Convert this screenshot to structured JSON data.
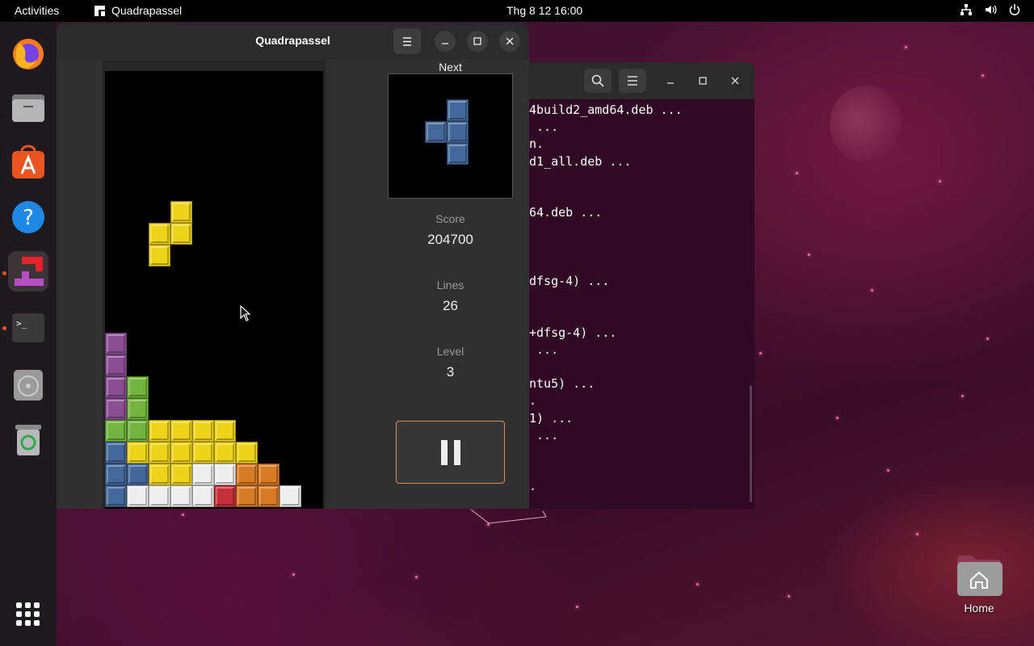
{
  "topbar": {
    "activities": "Activities",
    "app_name": "Quadrapassel",
    "clock": "Thg 8 12  16:00",
    "tray_icons": [
      "network-icon",
      "volume-icon",
      "power-icon"
    ]
  },
  "dock": {
    "items": [
      "firefox-icon",
      "files-icon",
      "app-center-icon",
      "help-icon",
      "quadrapassel-icon",
      "terminal-icon",
      "disc-icon",
      "trash-icon"
    ],
    "show_apps": "show-apps-icon"
  },
  "terminal": {
    "lines": [
      "4build2_amd64.deb ...",
      " ...",
      "n.",
      "d1_all.deb ...",
      "",
      "",
      "64.deb ...",
      "",
      "",
      "",
      "dfsg-4) ...",
      "",
      "",
      "+dfsg-4) ...",
      " ...",
      "",
      "ntu5) ...",
      ".",
      "1) ...",
      " ...",
      "",
      "",
      "."
    ]
  },
  "game": {
    "window_title": "Quadrapassel",
    "next_label": "Next",
    "score_label": "Score",
    "score": "204700",
    "lines_label": "Lines",
    "lines": "26",
    "level_label": "Level",
    "level": "3",
    "colors": {
      "purple": "#8a4f92",
      "green": "#72b43e",
      "yellow": "#eed31b",
      "blue": "#44689a",
      "white": "#eeeeee",
      "orange": "#d77b26",
      "red": "#c6303a"
    },
    "falling_piece": {
      "color": "yellow",
      "cells": [
        [
          3,
          6
        ],
        [
          2,
          7
        ],
        [
          3,
          7
        ],
        [
          2,
          8
        ]
      ]
    },
    "next_piece": {
      "color": "blue",
      "cells": [
        [
          1,
          0
        ],
        [
          0,
          1
        ],
        [
          1,
          1
        ],
        [
          1,
          2
        ]
      ]
    },
    "board": [
      {
        "row": 12,
        "cells": [
          "purple"
        ]
      },
      {
        "row": 13,
        "cells": [
          "purple"
        ]
      },
      {
        "row": 14,
        "cells": [
          "purple",
          "green"
        ]
      },
      {
        "row": 15,
        "cells": [
          "purple",
          "green"
        ]
      },
      {
        "row": 16,
        "cells": [
          "green",
          "green",
          "yellow",
          "yellow",
          "yellow",
          "yellow"
        ]
      },
      {
        "row": 17,
        "cells": [
          "blue",
          "yellow",
          "yellow",
          "yellow",
          "yellow",
          "yellow",
          "yellow"
        ]
      },
      {
        "row": 18,
        "cells": [
          "blue",
          "blue",
          "yellow",
          "yellow",
          "white",
          "white",
          "orange",
          "orange"
        ]
      },
      {
        "row": 19,
        "cells": [
          "blue",
          "white",
          "white",
          "white",
          "white",
          "red",
          "orange",
          "orange",
          "white"
        ]
      }
    ]
  },
  "desktop": {
    "home_label": "Home"
  }
}
